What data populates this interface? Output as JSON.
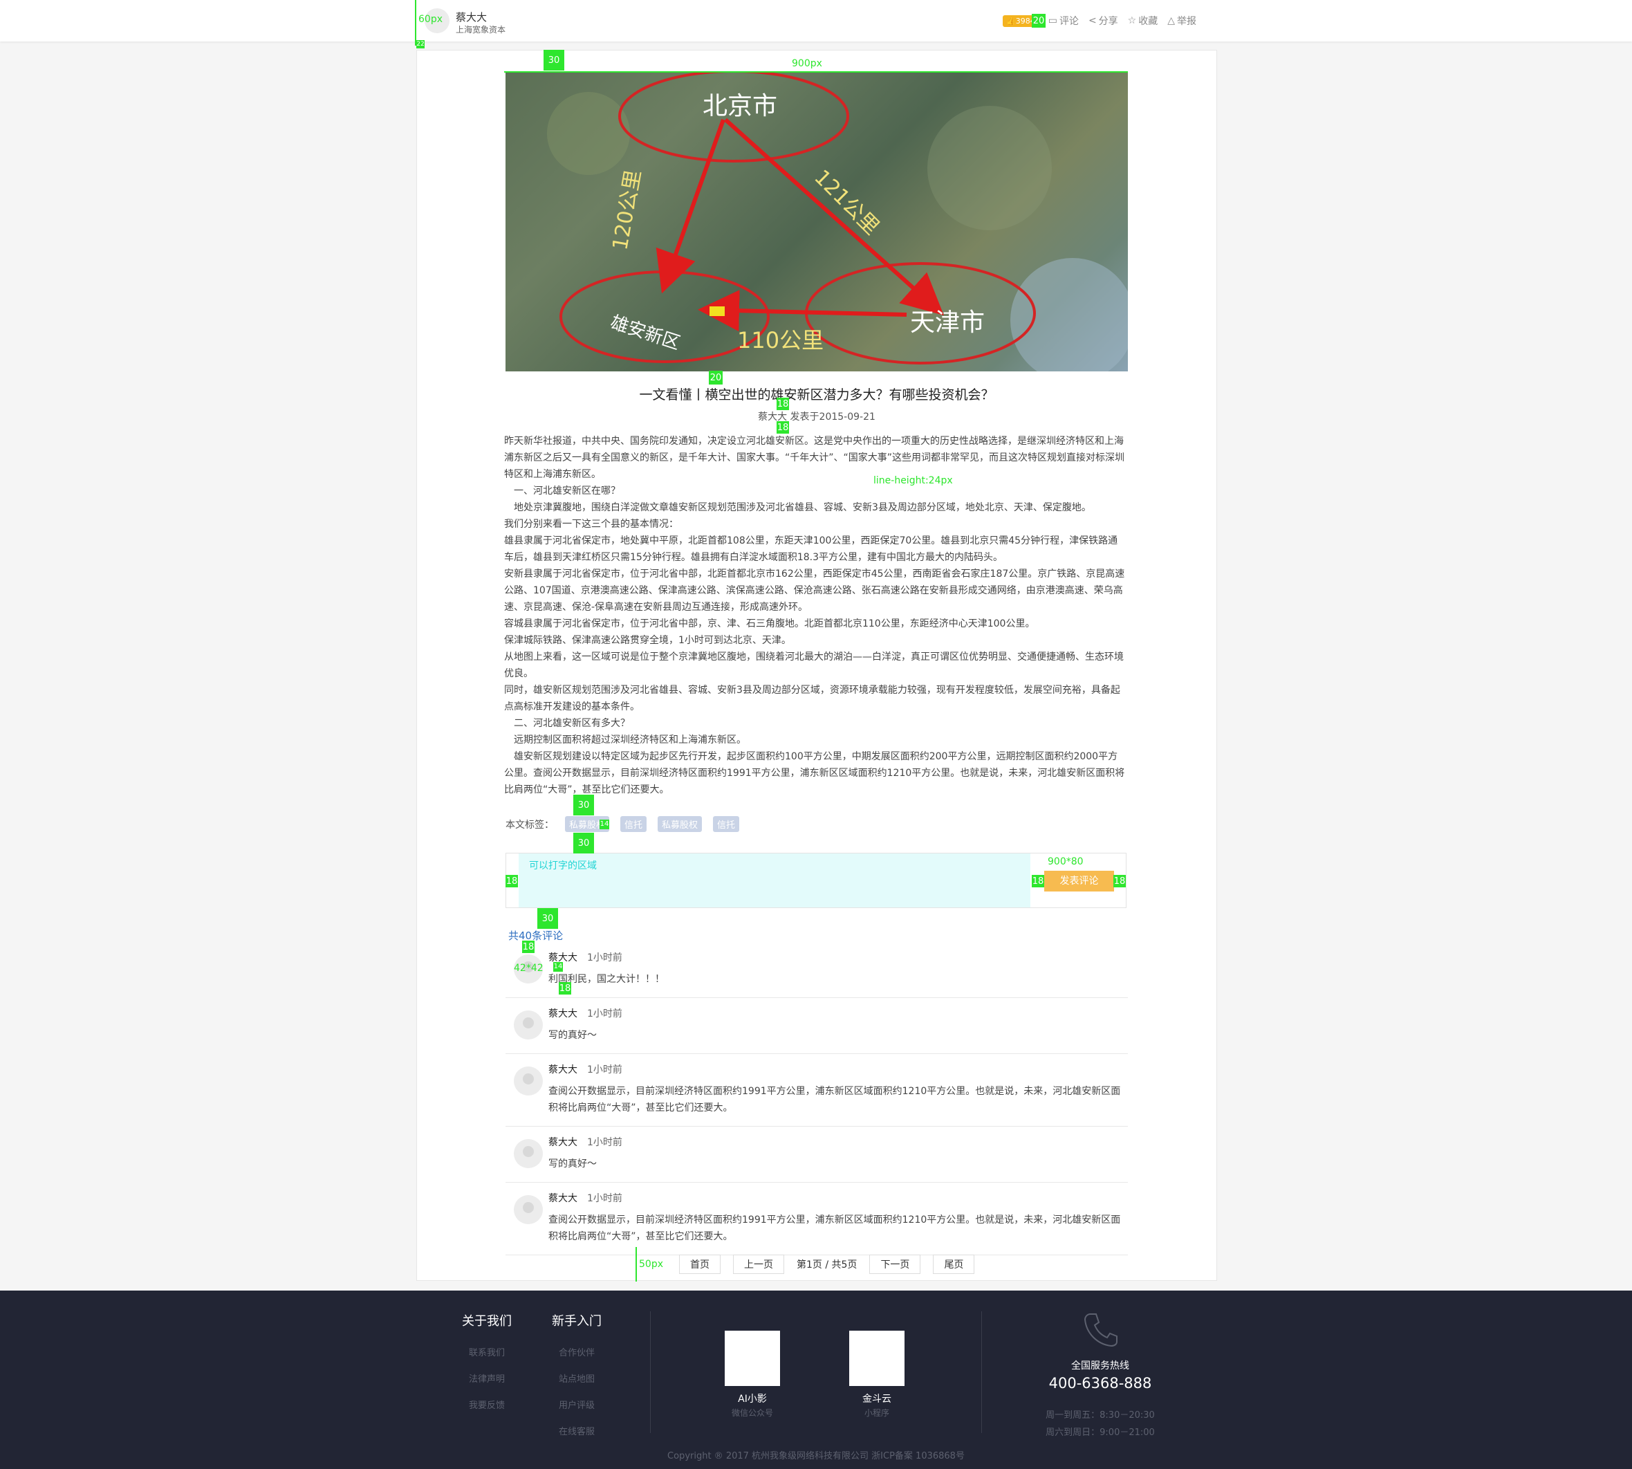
{
  "header": {
    "author_name": "蔡大大",
    "author_org": "上海宽象资本",
    "likes": "3984",
    "actions": {
      "comment": "评论",
      "share": "分享",
      "favorite": "收藏",
      "report": "举报"
    }
  },
  "article": {
    "hero_labels": {
      "beijing": "北京市",
      "tianjin": "天津市",
      "xiongan": "雄安新区",
      "d1": "120公里",
      "d2": "121公里",
      "d3": "110公里"
    },
    "title": "一文看懂丨横空出世的雄安新区潜力多大？有哪些投资机会？",
    "meta": "蔡大大 发表于2015-09-21",
    "paragraphs": [
      "昨天新华社报道，中共中央、国务院印发通知，决定设立河北雄安新区。这是党中央作出的一项重大的历史性战略选择，是继深圳经济特区和上海浦东新区之后又一具有全国意义的新区，是千年大计、国家大事。“千年大计”、“国家大事”这些用词都非常罕见，而且这次特区规划直接对标深圳特区和上海浦东新区。",
      "　一、河北雄安新区在哪？",
      "　地处京津冀腹地，围绕白洋淀做文章雄安新区规划范围涉及河北省雄县、容城、安新3县及周边部分区域，地处北京、天津、保定腹地。",
      "我们分别来看一下这三个县的基本情况：",
      " 雄县隶属于河北省保定市，地处冀中平原，北距首都108公里，东距天津100公里，西距保定70公里。雄县到北京只需45分钟行程，津保铁路通车后，雄县到天津红桥区只需15分钟行程。雄县拥有白洋淀水域面积18.3平方公里，建有中国北方最大的内陆码头。",
      " 安新县隶属于河北省保定市，位于河北省中部，北距首都北京市162公里，西距保定市45公里，西南距省会石家庄187公里。京广铁路、京昆高速公路、107国道、京港澳高速公路、保津高速公路、滨保高速公路、保沧高速公路、张石高速公路在安新县形成交通网络，由京港澳高速、荣乌高速、京昆高速、保沧-保阜高速在安新县周边互通连接，形成高速外环。",
      " 容城县隶属于河北省保定市，位于河北省中部，京、津、石三角腹地。北距首都北京110公里，东距经济中心天津100公里。",
      "保津城际铁路、保津高速公路贯穿全境，1小时可到达北京、天津。",
      " 从地图上来看，这一区域可说是位于整个京津冀地区腹地，围绕着河北最大的湖泊——白洋淀，真正可谓区位优势明显、交通便捷通畅、生态环境优良。",
      " 同时，雄安新区规划范围涉及河北省雄县、容城、安新3县及周边部分区域，资源环境承载能力较强，现有开发程度较低，发展空间充裕，具备起点高标准开发建设的基本条件。",
      "　二、河北雄安新区有多大？",
      "　远期控制区面积将超过深圳经济特区和上海浦东新区。",
      "　雄安新区规划建设以特定区域为起步区先行开发，起步区面积约100平方公里，中期发展区面积约200平方公里，远期控制区面积约2000平方公里。查阅公开数据显示，目前深圳经济特区面积约1991平方公里，浦东新区区域面积约1210平方公里。也就是说，未来，河北雄安新区面积将比肩两位“大哥”，甚至比它们还要大。"
    ],
    "tags_label": "本文标签：",
    "tags": [
      "私募股权",
      "信托",
      "私募股权",
      "信托"
    ]
  },
  "comment_box": {
    "placeholder": "可以打字的区域",
    "submit": "发表评论"
  },
  "comments_count": "共40条评论",
  "comments": [
    {
      "name": "蔡大大",
      "time": "1小时前",
      "text": "利国利民，国之大计！！！"
    },
    {
      "name": "蔡大大",
      "time": "1小时前",
      "text": "写的真好～"
    },
    {
      "name": "蔡大大",
      "time": "1小时前",
      "text": "查阅公开数据显示，目前深圳经济特区面积约1991平方公里，浦东新区区域面积约1210平方公里。也就是说，未来，河北雄安新区面积将比肩两位“大哥”，甚至比它们还要大。"
    },
    {
      "name": "蔡大大",
      "time": "1小时前",
      "text": "写的真好～"
    },
    {
      "name": "蔡大大",
      "time": "1小时前",
      "text": "查阅公开数据显示，目前深圳经济特区面积约1991平方公里，浦东新区区域面积约1210平方公里。也就是说，未来，河北雄安新区面积将比肩两位“大哥”，甚至比它们还要大。"
    }
  ],
  "pager": {
    "first": "首页",
    "prev": "上一页",
    "info": "第1页 / 共5页",
    "next": "下一页",
    "last": "尾页"
  },
  "annotations": {
    "m60": "60px",
    "m22": "22",
    "m30a": "30",
    "m900": "900px",
    "m20a": "20",
    "m20b": "20",
    "m18a": "18",
    "m18b": "18",
    "lh": "line-height:24px",
    "m30b": "30",
    "m14a": "14",
    "m30c": "30",
    "m18l": "18",
    "m18m": "18",
    "m18r": "18",
    "m900x80": "900*80",
    "m30d": "30",
    "m18c": "18",
    "m42": "42*42",
    "m14b": "14",
    "m18d": "18",
    "m50": "50px"
  },
  "footer": {
    "col1": {
      "title": "关于我们",
      "links": [
        "联系我们",
        "法律声明",
        "我要反馈"
      ]
    },
    "col2": {
      "title": "新手入门",
      "links": [
        "合作伙伴",
        "站点地图",
        "用户评级",
        "在线客服"
      ]
    },
    "qr1": {
      "name": "AI小影",
      "sub": "微信公众号"
    },
    "qr2": {
      "name": "金斗云",
      "sub": "小程序"
    },
    "hotline_label": "全国服务热线",
    "hotline": "400-6368-888",
    "hours": [
      "周一到周五：8:30－20:30",
      "周六到周日：9:00－21:00"
    ],
    "copyright": "Copyright ® 2017 杭州我象级网络科技有限公司 浙ICP备案 1036868号"
  },
  "colors": {
    "accent_green": "#2ee62e",
    "like_badge": "#f4b320",
    "submit_button": "#f7bb50",
    "comment_area": "#e3fbfb",
    "tag_bg": "#c9d3e6",
    "footer_bg": "#222534"
  }
}
